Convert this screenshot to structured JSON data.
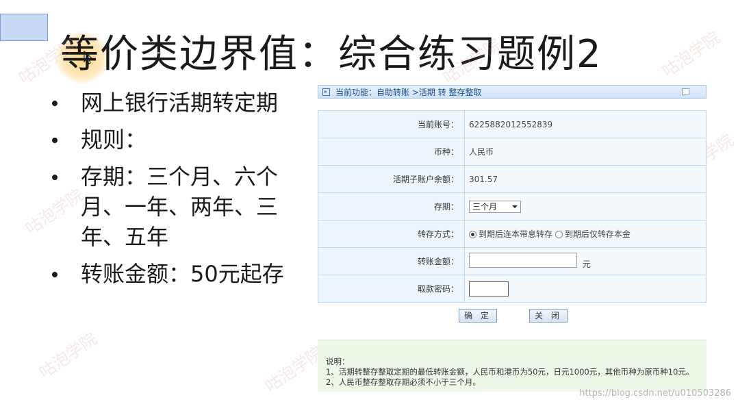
{
  "slide": {
    "title": "等价类边界值：综合练习题例2",
    "bullets": [
      "网上银行活期转定期",
      "规则：",
      "存期：三个月、六个月、一年、两年、三年、五年",
      "转账金额：50元起存"
    ]
  },
  "watermark_text": "咕泡学院",
  "bank_form": {
    "titlebar": "当前功能：自助转账 >活期 转 整存整取",
    "rows": [
      {
        "label": "当前账号：",
        "value": "6225882012552839"
      },
      {
        "label": "币种：",
        "value": "人民币"
      },
      {
        "label": "活期子账户余额：",
        "value": "301.57"
      }
    ],
    "term": {
      "label": "存期：",
      "selected": "三个月"
    },
    "method": {
      "label": "转存方式：",
      "option1": "到期后连本带息转存",
      "option2": "到期后仅转存本金"
    },
    "amount": {
      "label": "转账金额：",
      "value": "",
      "unit": "元"
    },
    "password": {
      "label": "取款密码：",
      "value": ""
    },
    "buttons": {
      "ok": "确 定",
      "close": "关 闭"
    },
    "notes": {
      "heading": "说明：",
      "line1": "1、活期转整存整取定期的最低转账金额，人民币和港币为50元，日元1000元，其他币种为原币种10元。",
      "line2": "2、人民币整存整取存期必须不小于三个月。"
    }
  },
  "credit": "https://blog.csdn.net/u010503286"
}
